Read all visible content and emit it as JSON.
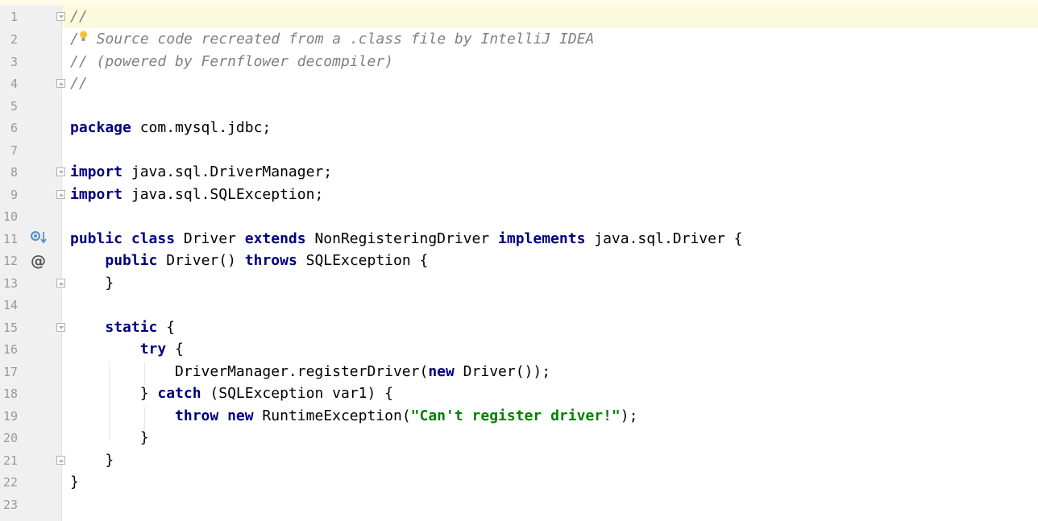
{
  "editor": {
    "line_numbers": [
      "1",
      "2",
      "3",
      "4",
      "5",
      "6",
      "7",
      "8",
      "9",
      "10",
      "11",
      "12",
      "13",
      "14",
      "15",
      "16",
      "17",
      "18",
      "19",
      "20",
      "21",
      "22",
      "23"
    ],
    "lines": {
      "l1_comment": "//",
      "l2_comment": " Source code recreated from a .class file by IntelliJ IDEA",
      "l3_comment": "// (powered by Fernflower decompiler)",
      "l4_comment": "//",
      "l6_kw": "package",
      "l6_text": " com.mysql.jdbc;",
      "l8_kw": "import",
      "l8_text": " java.sql.DriverManager;",
      "l9_kw": "import",
      "l9_text": " java.sql.SQLException;",
      "l11_kw1": "public class",
      "l11_t1": " Driver ",
      "l11_kw2": "extends",
      "l11_t2": " NonRegisteringDriver ",
      "l11_kw3": "implements",
      "l11_t3": " java.sql.Driver {",
      "l12_indent": "    ",
      "l12_kw1": "public",
      "l12_t1": " Driver() ",
      "l12_kw2": "throws",
      "l12_t2": " SQLException {",
      "l13_text": "    }",
      "l15_indent": "    ",
      "l15_kw": "static",
      "l15_t": " {",
      "l16_indent": "        ",
      "l16_kw": "try",
      "l16_t": " {",
      "l17_t1": "            DriverManager.registerDriver(",
      "l17_kw": "new",
      "l17_t2": " Driver());",
      "l18_t1": "        } ",
      "l18_kw": "catch",
      "l18_t2": " (SQLException var1) {",
      "l19_indent": "            ",
      "l19_kw1": "throw",
      "l19_sp": " ",
      "l19_kw2": "new",
      "l19_t1": " RuntimeException(",
      "l19_str": "\"Can't register driver!\"",
      "l19_t2": ");",
      "l20_text": "        }",
      "l21_text": "    }",
      "l22_text": "}"
    }
  },
  "gutter_icons": {
    "line11": "implements-interface-icon",
    "line12_glyph": "@",
    "line2_hint": "intention-bulb-icon"
  },
  "colors": {
    "keyword": "#000080",
    "comment": "#808080",
    "string": "#008000",
    "gutter_bg": "#f0f0f0",
    "caret_line": "#fcfadd"
  }
}
